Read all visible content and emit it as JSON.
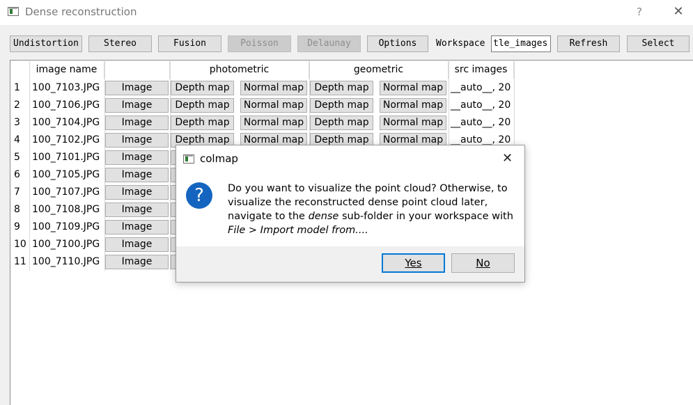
{
  "window": {
    "title": "Dense reconstruction",
    "help": "?",
    "close": "✕"
  },
  "toolbar": {
    "buttons": [
      {
        "label": "Undistortion",
        "enabled": true
      },
      {
        "label": "Stereo",
        "enabled": true
      },
      {
        "label": "Fusion",
        "enabled": true
      },
      {
        "label": "Poisson",
        "enabled": false
      },
      {
        "label": "Delaunay",
        "enabled": false
      },
      {
        "label": "Options",
        "enabled": true
      }
    ],
    "workspace_label": "Workspace",
    "workspace_value": "tle_images",
    "refresh_label": "Refresh",
    "select_label": "Select"
  },
  "table": {
    "headers": {
      "image_name": "image name",
      "photometric": "photometric",
      "geometric": "geometric",
      "src_images": "src images"
    },
    "button_labels": {
      "image": "Image",
      "depth_map": "Depth map",
      "normal_map": "Normal map"
    },
    "rows": [
      {
        "num": "1",
        "name": "100_7103.JPG",
        "src": "__auto__, 20"
      },
      {
        "num": "2",
        "name": "100_7106.JPG",
        "src": "__auto__, 20"
      },
      {
        "num": "3",
        "name": "100_7104.JPG",
        "src": "__auto__, 20"
      },
      {
        "num": "4",
        "name": "100_7102.JPG",
        "src": "__auto__, 20"
      },
      {
        "num": "5",
        "name": "100_7101.JPG",
        "src": ""
      },
      {
        "num": "6",
        "name": "100_7105.JPG",
        "src": ""
      },
      {
        "num": "7",
        "name": "100_7107.JPG",
        "src": ""
      },
      {
        "num": "8",
        "name": "100_7108.JPG",
        "src": ""
      },
      {
        "num": "9",
        "name": "100_7109.JPG",
        "src": ""
      },
      {
        "num": "10",
        "name": "100_7100.JPG",
        "src": ""
      },
      {
        "num": "11",
        "name": "100_7110.JPG",
        "src": ""
      }
    ]
  },
  "dialog": {
    "title": "colmap",
    "close": "✕",
    "icon": "?",
    "msg_part1": "Do you want to visualize the point cloud? Otherwise, to visualize the reconstructed dense point cloud later, navigate to the ",
    "msg_dense": "dense",
    "msg_part2": " sub-folder in your workspace with ",
    "msg_path": "File > Import model from....",
    "yes_label": "Yes",
    "no_label": "No"
  }
}
